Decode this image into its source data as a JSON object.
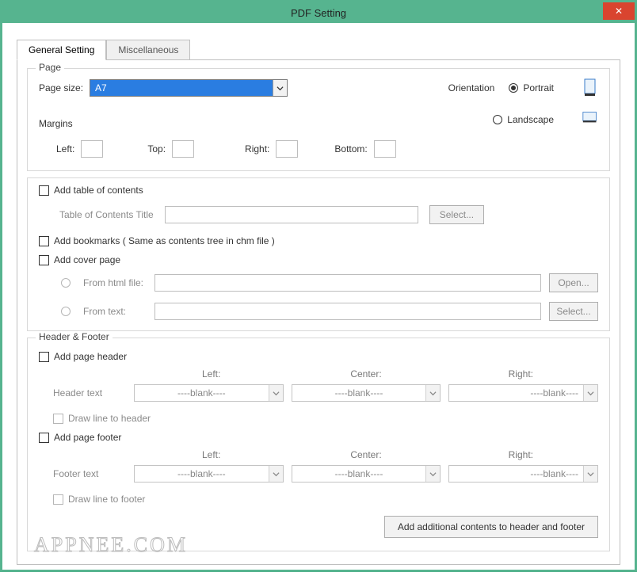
{
  "title": "PDF Setting",
  "tabs": {
    "general": "General Setting",
    "misc": "Miscellaneous"
  },
  "page": {
    "legend": "Page",
    "size_label": "Page size:",
    "size_value": "A7",
    "orientation_label": "Orientation",
    "portrait": "Portrait",
    "landscape": "Landscape",
    "margins_label": "Margins",
    "left": "Left:",
    "top": "Top:",
    "right": "Right:",
    "bottom": "Bottom:"
  },
  "toc": {
    "add_toc": "Add table of contents",
    "title_label": "Table of Contents Title",
    "select": "Select...",
    "add_bookmarks": "Add  bookmarks ( Same as contents tree in chm file )",
    "add_cover": "Add cover page",
    "from_html": "From html file:",
    "from_text": "From  text:",
    "open": "Open...",
    "select2": "Select..."
  },
  "hf": {
    "legend": "Header & Footer",
    "add_header": "Add page header",
    "add_footer": "Add page footer",
    "left": "Left:",
    "center": "Center:",
    "right": "Right:",
    "header_text": "Header text",
    "footer_text": "Footer text",
    "blank": "----blank----",
    "draw_header": "Draw line to header",
    "draw_footer": "Draw line to footer",
    "additional": "Add additional contents to header and footer"
  },
  "watermark": "APPNEE.COM"
}
